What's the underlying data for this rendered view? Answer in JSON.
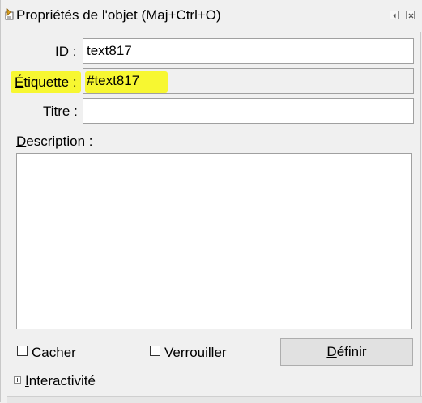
{
  "window": {
    "title": "Propriétés de l'objet (Maj+Ctrl+O)"
  },
  "fields": {
    "id": {
      "label_first": "I",
      "label_rest": "D :",
      "value": "text817"
    },
    "etiquette": {
      "label_first": "É",
      "label_rest": "tiquette :",
      "value": "#text817"
    },
    "titre": {
      "label_first": "T",
      "label_rest": "itre :",
      "value": ""
    },
    "description": {
      "label_first": "D",
      "label_rest": "escription :",
      "value": ""
    }
  },
  "options": {
    "hide": {
      "label_first": "C",
      "label_rest": "acher",
      "checked": false
    },
    "lock": {
      "label_pre": "Verr",
      "label_ul": "o",
      "label_post": "uiller",
      "checked": false
    }
  },
  "buttons": {
    "define": {
      "label_first": "D",
      "label_rest": "éfinir"
    }
  },
  "interactivity": {
    "label_first": "I",
    "label_rest": "nteractivité",
    "expanded": false
  },
  "colors": {
    "highlight": "#f7f731",
    "background": "#f0f0f0",
    "field_border": "#a0a0a0"
  }
}
